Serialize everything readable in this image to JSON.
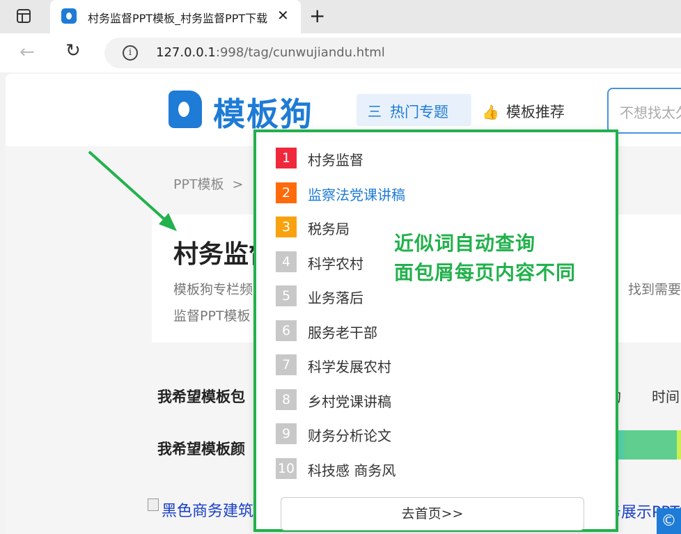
{
  "browser": {
    "tab_title": "村务监督PPT模板_村务监督PPT下载",
    "tab_close": "✕",
    "new_tab": "+",
    "back": "←",
    "reload": "↻",
    "info": "i",
    "url_host": "127.0.0.1",
    "url_rest": ":998/tag/cunwujiandu.html"
  },
  "header": {
    "logo_text": "模板狗",
    "nav_hot_icon": "三",
    "nav_hot": "热门专题",
    "nav_rec_icon": "👍",
    "nav_rec": "模板推荐",
    "search_placeholder": "不想找太久"
  },
  "breadcrumb": {
    "root": "PPT模板",
    "sep": ">"
  },
  "intro": {
    "title": "村务监督",
    "line1": "模板狗专栏频",
    "line2": "监督PPT模板",
    "line1_right": "找到需要的"
  },
  "filters": {
    "label1": "我希望模板包",
    "r1": "构",
    "r2": "时间",
    "label2": "我希望模板颜"
  },
  "listing": {
    "img_alt_left": "黑色商务建筑",
    "img_alt_right": "务展示PPT模"
  },
  "dropdown": {
    "items": [
      {
        "num": "1",
        "label": "村务监督",
        "color": "#f0283c"
      },
      {
        "num": "2",
        "label": "监察法党课讲稿",
        "color": "#ff6b0b"
      },
      {
        "num": "3",
        "label": "税务局",
        "color": "#f8a20f"
      },
      {
        "num": "4",
        "label": "科学农村",
        "color": "#c8c8c8"
      },
      {
        "num": "5",
        "label": "业务落后",
        "color": "#c8c8c8"
      },
      {
        "num": "6",
        "label": "服务老干部",
        "color": "#c8c8c8"
      },
      {
        "num": "7",
        "label": "科学发展农村",
        "color": "#c8c8c8"
      },
      {
        "num": "8",
        "label": "乡村党课讲稿",
        "color": "#c8c8c8"
      },
      {
        "num": "9",
        "label": "财务分析论文",
        "color": "#c8c8c8"
      },
      {
        "num": "10",
        "label": "科技感 商务风",
        "color": "#c8c8c8"
      }
    ],
    "home_button": "去首页>>"
  },
  "annotation": {
    "line1": "近似词自动查询",
    "line2": "面包屑每页内容不同"
  },
  "badge": "©",
  "colors": {
    "brand": "#1e7bd6",
    "annotation": "#22b14c"
  }
}
